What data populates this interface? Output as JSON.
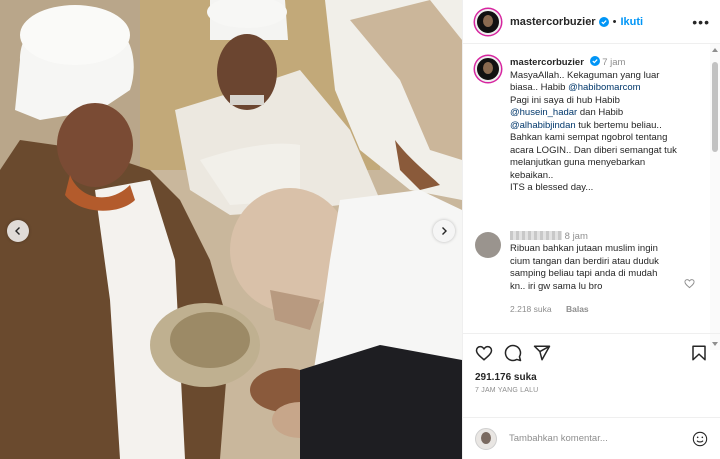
{
  "post": {
    "username": "mastercorbuzier",
    "follow_label": "Ikuti",
    "dot": "•",
    "more_label": "•••"
  },
  "caption": {
    "username": "mastercorbuzier",
    "time": "7 jam",
    "lines": {
      "l1": "MasyaAllah.. Kekaguman yang luar",
      "l2_pre": "biasa.. Habib ",
      "l2_mention": "@habibomarcom",
      "l3": "Pagi ini saya di hub Habib",
      "l4_mention": "@husein_hadar",
      "l4_post": " dan Habib",
      "l5_mention": "@alhabibjindan",
      "l5_post": " tuk bertemu beliau..",
      "l6": "Bahkan kami sempat ngobrol tentang",
      "l7": "acara LOGIN.. Dan diberi semangat tuk",
      "l8": "melanjutkan guna menyebarkan",
      "l9": "kebaikan..",
      "l10": "ITS a blessed day..."
    }
  },
  "comment": {
    "time": "8 jam",
    "lines": {
      "l1": "Ribuan bahkan jutaan muslim ingin",
      "l2": "cium tangan dan berdiri atau duduk",
      "l3": "samping beliau tapi anda di mudah",
      "l4": "kn.. iri gw sama lu bro"
    },
    "likes": "2.218 suka",
    "reply_label": "Balas"
  },
  "engagement": {
    "likes": "291.176 suka",
    "time_ago": "7 JAM YANG LALU"
  },
  "add_comment": {
    "placeholder": "Tambahkan komentar..."
  },
  "icons": {
    "like": "heart-icon",
    "comment": "comment-icon",
    "share": "share-icon",
    "save": "bookmark-icon",
    "emoji": "emoji-icon",
    "verified": "verified-badge-icon"
  },
  "colors": {
    "link": "#00376b",
    "follow": "#0095f6",
    "muted": "#8e8e8e",
    "verified": "#0095f6"
  }
}
